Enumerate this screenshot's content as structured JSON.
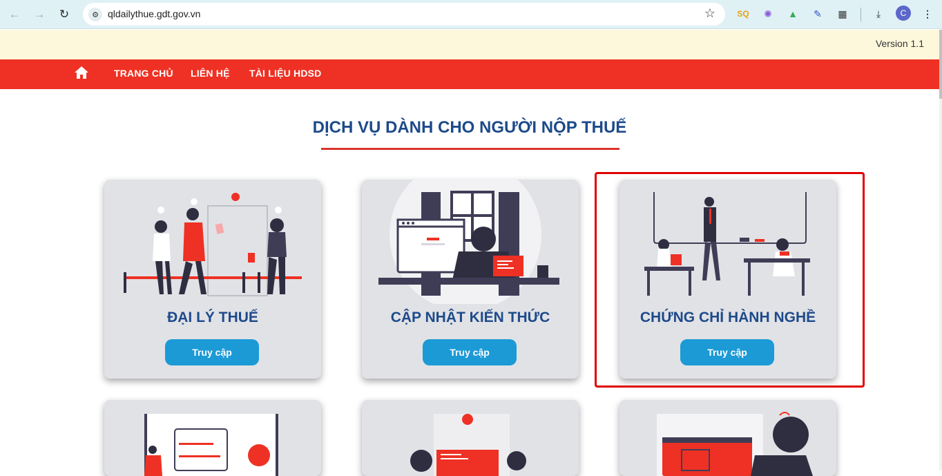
{
  "browser": {
    "url": "qldailythue.gdt.gov.vn",
    "profile_initial": "C"
  },
  "header": {
    "version": "Version 1.1"
  },
  "nav": {
    "items": [
      {
        "label": "TRANG CHỦ"
      },
      {
        "label": "LIÊN HỆ"
      },
      {
        "label": "TÀI LIỆU HDSD"
      }
    ]
  },
  "section": {
    "title": "DỊCH VỤ DÀNH CHO NGƯỜI NỘP THUẾ"
  },
  "cards": [
    {
      "title": "ĐẠI LÝ THUẾ",
      "button": "Truy cập"
    },
    {
      "title": "CẬP NHẬT KIẾN THỨC",
      "button": "Truy cập"
    },
    {
      "title": "CHỨNG CHỈ HÀNH NGHỀ",
      "button": "Truy cập"
    }
  ],
  "colors": {
    "accent_red": "#ee3124",
    "title_blue": "#1d4a8a",
    "button_blue": "#1b9ad6"
  }
}
